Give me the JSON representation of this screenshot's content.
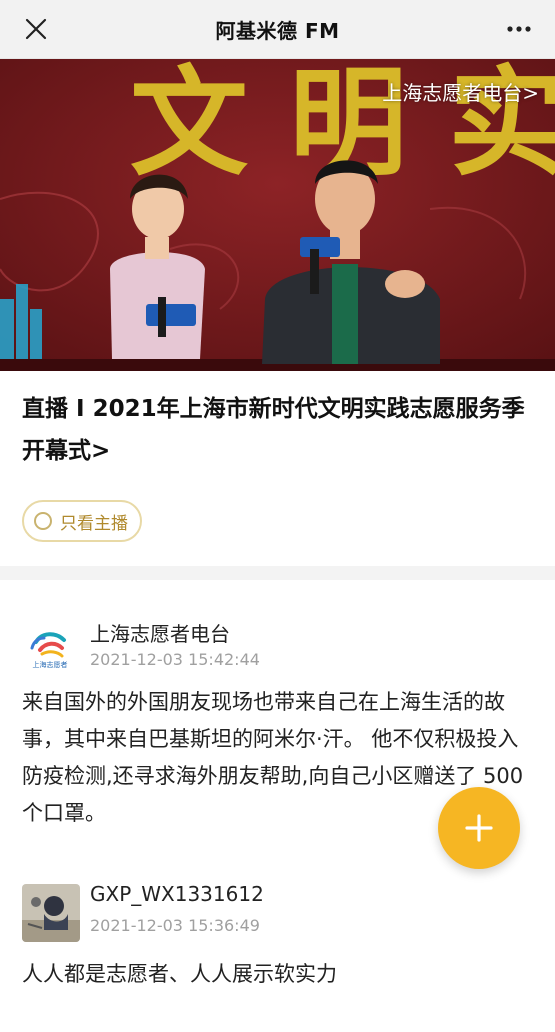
{
  "header": {
    "title": "阿基米德 FM",
    "close_icon": "close-icon",
    "more_icon": "more-dots-icon"
  },
  "banner": {
    "station_link": "上海志愿者电台>",
    "backdrop_text": "文 明 实"
  },
  "program": {
    "headline": "直播 I 2021年上海市新时代文明实践志愿服务季开幕式>",
    "filter_label": "只看主播"
  },
  "posts": [
    {
      "author": "上海志愿者电台",
      "time": "2021-12-03 15:42:44",
      "text": "来自国外的外国朋友现场也带来自己在上海生活的故事，其中来自巴基斯坦的阿米尔·汗。 他不仅积极投入防疫检测,还寻求海外朋友帮助,向自己小区赠送了 500 个口罩。",
      "avatar_icon": "station-logo-icon",
      "avatar_caption": "上海志愿者"
    },
    {
      "author": "GXP_WX1331612",
      "time": "2021-12-03 15:36:49",
      "text": "人人都是志愿者、人人展示软实力",
      "avatar_icon": "user-photo-avatar"
    }
  ],
  "fab": {
    "icon": "plus-icon",
    "color": "#f6b623"
  },
  "colors": {
    "accent": "#f6b623",
    "filter_border": "#e8d9a6",
    "filter_text": "#b08a2e",
    "banner_bg": "#7a1b1f"
  }
}
